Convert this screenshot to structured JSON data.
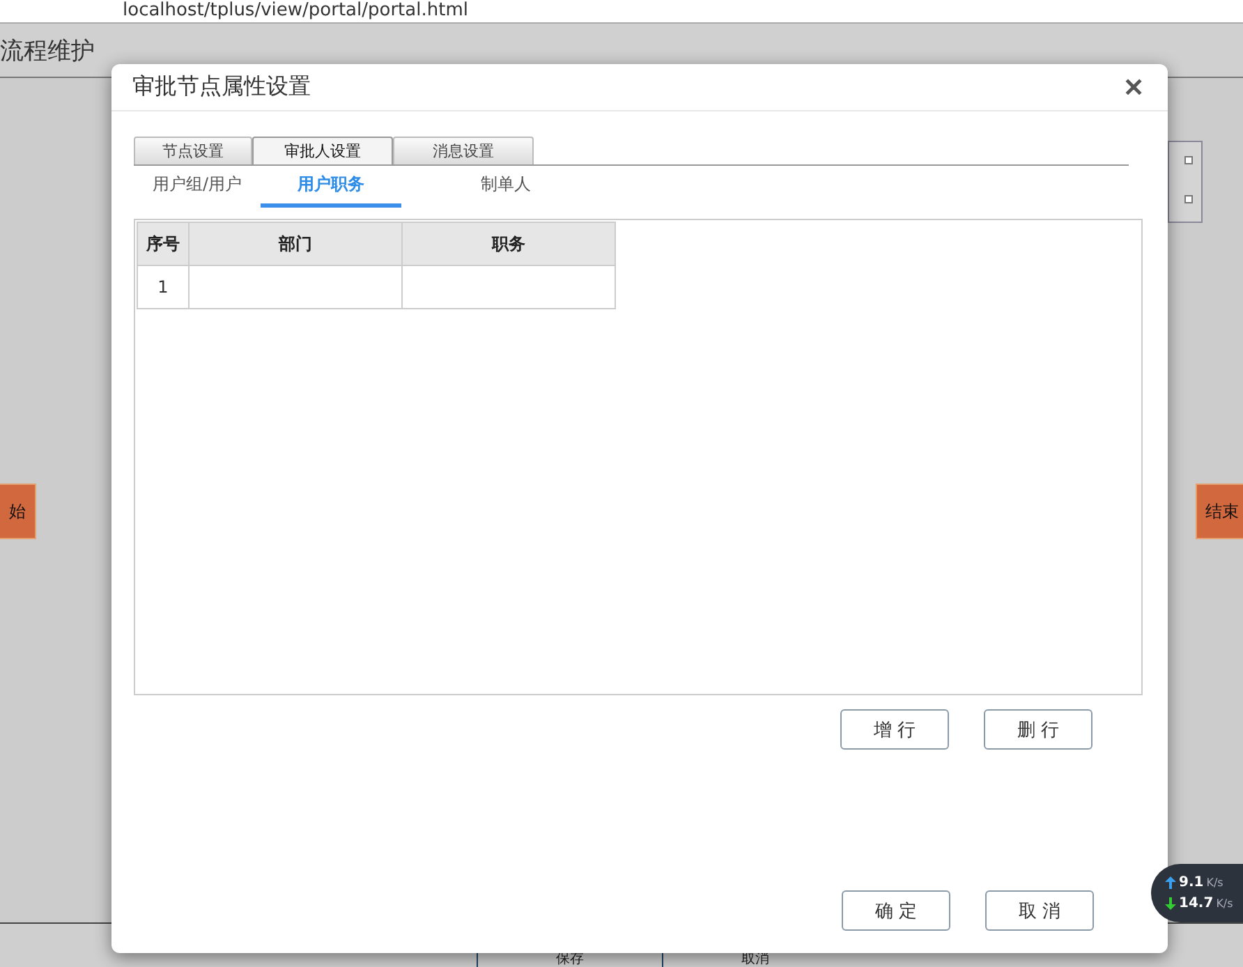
{
  "browser": {
    "url": "localhost/tplus/view/portal/portal.html"
  },
  "page": {
    "title": "流程维护",
    "nodes": [
      {
        "kind": "start",
        "label": "始"
      },
      {
        "kind": "end",
        "label": "结束"
      }
    ],
    "bottom_buttons": [
      "保存",
      "取消"
    ]
  },
  "dialog": {
    "title": "审批节点属性设置",
    "close": "✕",
    "tabs": [
      {
        "label": "节点设置",
        "selected": false
      },
      {
        "label": "审批人设置",
        "selected": true
      },
      {
        "label": "消息设置",
        "selected": false
      }
    ],
    "subtabs": [
      {
        "label": "用户组/用户",
        "selected": false
      },
      {
        "label": "用户职务",
        "selected": true
      },
      {
        "label": "制单人",
        "selected": false
      }
    ],
    "table": {
      "columns": [
        "序号",
        "部门",
        "职务"
      ],
      "rows": [
        [
          "1",
          "",
          ""
        ]
      ]
    },
    "row_buttons": [
      "增 行",
      "删 行"
    ],
    "footer_buttons": [
      "确 定",
      "取 消"
    ]
  },
  "netspeed": {
    "up": "9.1",
    "up_unit": "K/s",
    "down": "14.7",
    "down_unit": "K/s"
  }
}
